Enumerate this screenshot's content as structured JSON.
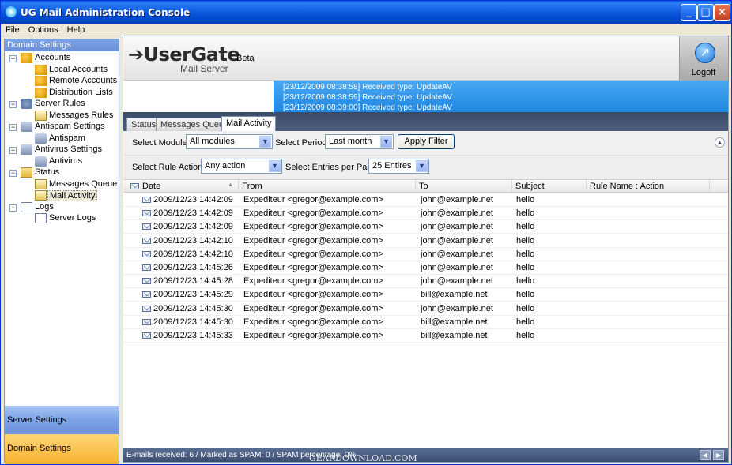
{
  "window": {
    "title": "UG Mail Administration Console",
    "min": "_",
    "max": "□",
    "close": "×"
  },
  "menu": [
    "File",
    "Options",
    "Help"
  ],
  "left_panel": {
    "header": "Domain Settings",
    "tree": [
      {
        "label": "Accounts",
        "level": 0,
        "icon": "accounts-icon"
      },
      {
        "label": "Local Accounts",
        "level": 1,
        "icon": "local-accounts-icon"
      },
      {
        "label": "Remote Accounts",
        "level": 1,
        "icon": "remote-accounts-icon"
      },
      {
        "label": "Distribution Lists",
        "level": 1,
        "icon": "distribution-lists-icon"
      },
      {
        "label": "Server Rules",
        "level": 0,
        "icon": "server-rules-icon"
      },
      {
        "label": "Messages Rules",
        "level": 1,
        "icon": "messages-rules-icon"
      },
      {
        "label": "Antispam Settings",
        "level": 0,
        "icon": "antispam-settings-icon"
      },
      {
        "label": "Antispam",
        "level": 1,
        "icon": "antispam-icon"
      },
      {
        "label": "Antivirus Settings",
        "level": 0,
        "icon": "antivirus-settings-icon"
      },
      {
        "label": "Antivirus",
        "level": 1,
        "icon": "antivirus-icon"
      },
      {
        "label": "Status",
        "level": 0,
        "icon": "status-icon"
      },
      {
        "label": "Messages Queue",
        "level": 1,
        "icon": "messages-queue-icon"
      },
      {
        "label": "Mail Activity",
        "level": 1,
        "icon": "mail-activity-icon",
        "selected": true
      },
      {
        "label": "Logs",
        "level": 0,
        "icon": "logs-icon"
      },
      {
        "label": "Server Logs",
        "level": 1,
        "icon": "server-logs-icon"
      }
    ],
    "server_settings": "Server Settings",
    "domain_settings": "Domain Settings"
  },
  "banner": {
    "logo": "UserGate",
    "beta": "Beta",
    "subtitle": "Mail Server",
    "logoff": "Logoff"
  },
  "events": [
    "[23/12/2009 08:38:58] Received type: UpdateAV",
    "[23/12/2009 08:38:59] Received type: UpdateAV",
    "[23/12/2009 08:39:00] Received type: UpdateAV"
  ],
  "tabs": [
    "Status",
    "Messages Queue",
    "Mail Activity"
  ],
  "filters": {
    "module_label": "Select Module:",
    "module_value": "All modules",
    "period_label": "Select Period:",
    "period_value": "Last month",
    "apply": "Apply Filter",
    "rule_label": "Select Rule Action:",
    "rule_value": "Any action",
    "entries_label": "Select Entries per Page:",
    "entries_value": "25 Entires"
  },
  "grid": {
    "columns": [
      "Date",
      "From",
      "To",
      "Subject",
      "Rule Name : Action"
    ],
    "rows": [
      [
        "2009/12/23 14:42:09",
        "Expediteur <gregor@example.com>",
        "john@example.net",
        "hello",
        ""
      ],
      [
        "2009/12/23 14:42:09",
        "Expediteur <gregor@example.com>",
        "john@example.net",
        "hello",
        ""
      ],
      [
        "2009/12/23 14:42:09",
        "Expediteur <gregor@example.com>",
        "john@example.net",
        "hello",
        ""
      ],
      [
        "2009/12/23 14:42:10",
        "Expediteur <gregor@example.com>",
        "john@example.net",
        "hello",
        ""
      ],
      [
        "2009/12/23 14:42:10",
        "Expediteur <gregor@example.com>",
        "john@example.net",
        "hello",
        ""
      ],
      [
        "2009/12/23 14:45:26",
        "Expediteur <gregor@example.com>",
        "john@example.net",
        "hello",
        ""
      ],
      [
        "2009/12/23 14:45:28",
        "Expediteur <gregor@example.com>",
        "john@example.net",
        "hello",
        ""
      ],
      [
        "2009/12/23 14:45:29",
        "Expediteur <gregor@example.com>",
        "bill@example.net",
        "hello",
        ""
      ],
      [
        "2009/12/23 14:45:30",
        "Expediteur <gregor@example.com>",
        "john@example.net",
        "hello",
        ""
      ],
      [
        "2009/12/23 14:45:30",
        "Expediteur <gregor@example.com>",
        "bill@example.net",
        "hello",
        ""
      ],
      [
        "2009/12/23 14:45:33",
        "Expediteur <gregor@example.com>",
        "bill@example.net",
        "hello",
        ""
      ]
    ]
  },
  "status": "E-mails received: 6 / Marked as SPAM: 0 / SPAM percentage: 0%",
  "watermark": "GEARDOWNLOAD.COM"
}
